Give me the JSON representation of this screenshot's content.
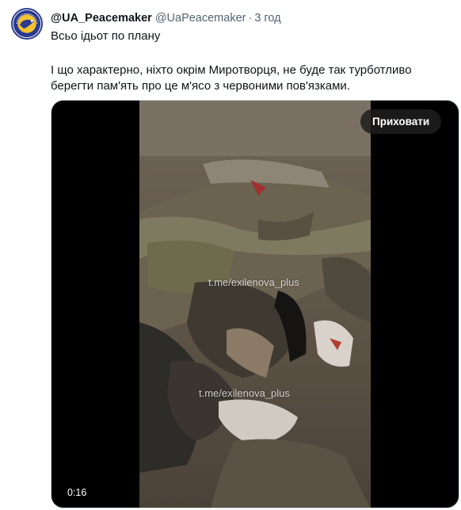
{
  "tweet": {
    "display_name": "@UA_Peacemaker",
    "handle": "@UaPeacemaker",
    "separator": "·",
    "time": "3 год",
    "text_line1": "Всьо ідьот по плану",
    "text_line2": "І що характерно, ніхто окрім Миротворця, не буде так турботливо",
    "text_line3": "берегти пам'ять про це м'ясо з червоними пов'язками."
  },
  "media": {
    "hide_button_label": "Приховати",
    "watermark_top": "t.me/exilenova_plus",
    "watermark_bottom": "t.me/exilenova_plus",
    "timestamp": "0:16"
  },
  "colors": {
    "text": "#0f1419",
    "secondary_text": "#536471",
    "avatar_border": "#2a3a8f",
    "media_border": "#cfd9de"
  },
  "icons": {
    "avatar": "peacemaker-logo-icon"
  }
}
